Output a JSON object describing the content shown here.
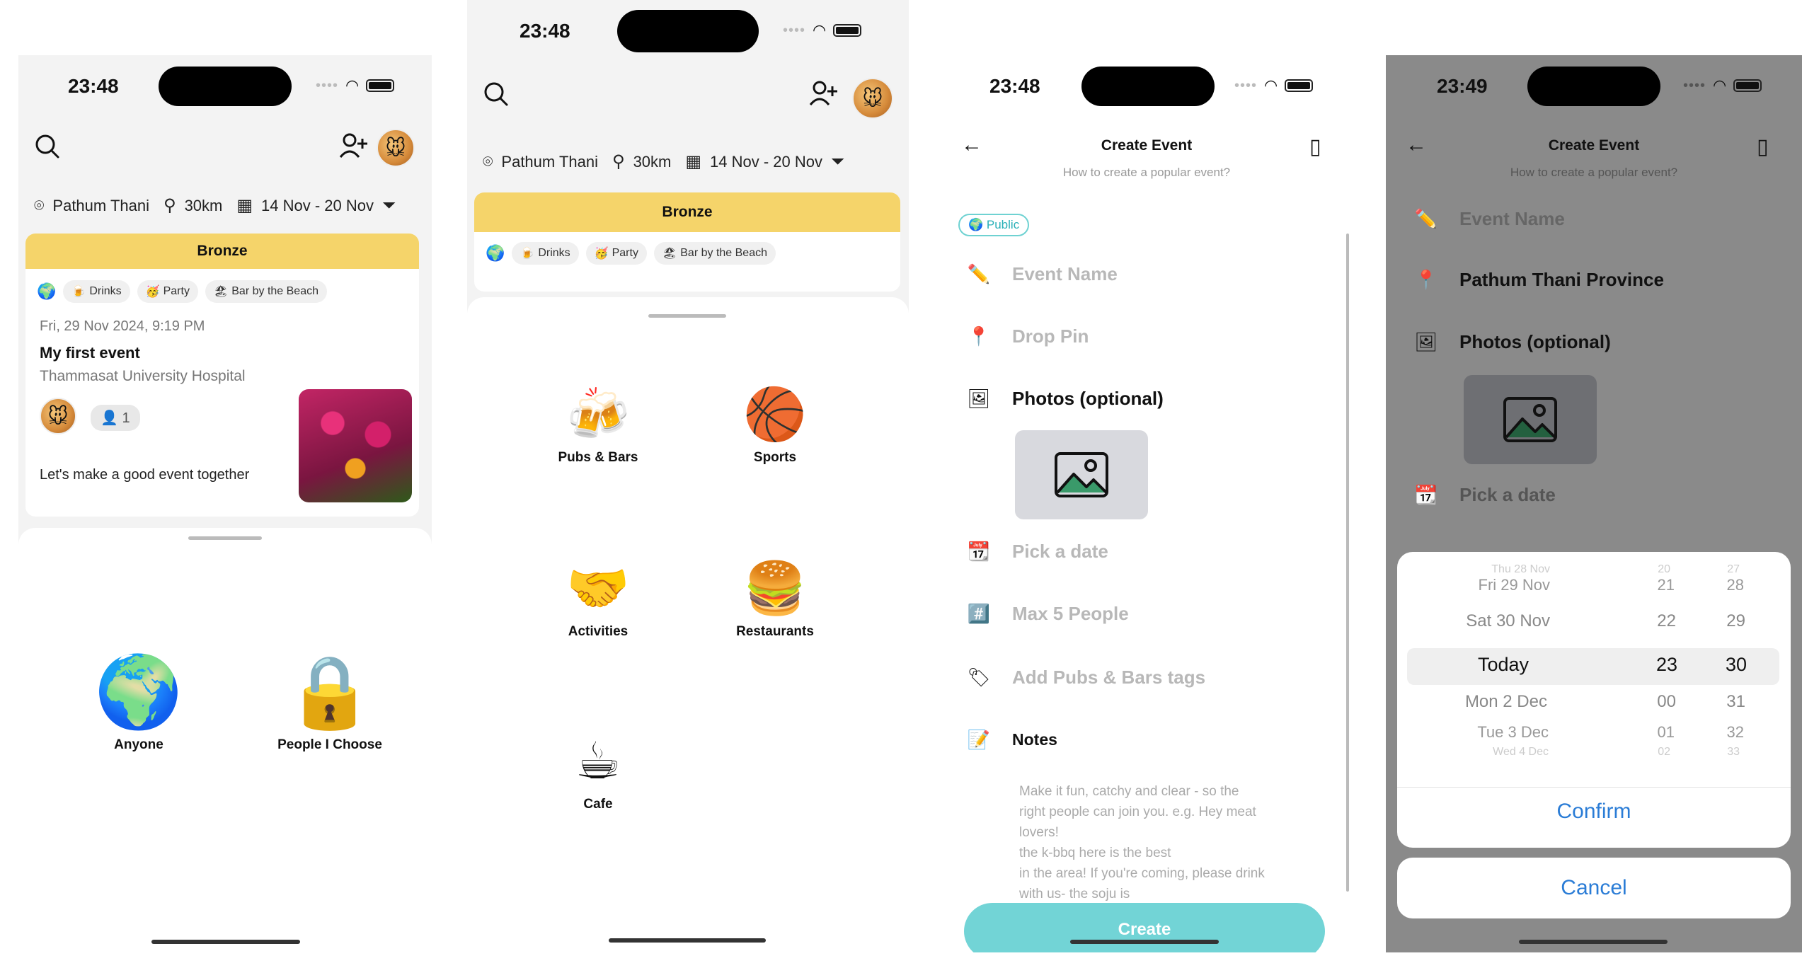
{
  "screen1": {
    "status_time": "23:48",
    "location": "Pathum Thani",
    "distance": "30km",
    "date_range": "14 Nov - 20 Nov",
    "tier": "Bronze",
    "tags": [
      "Drinks",
      "Party",
      "Bar by the Beach"
    ],
    "event": {
      "datetime": "Fri, 29 Nov 2024, 9:19 PM",
      "title": "My first event",
      "venue": "Thammasat University Hospital",
      "attendee_count": "1",
      "description": "Let's make a good event together"
    },
    "options": [
      {
        "label": "Anyone",
        "icon": "globe-icon"
      },
      {
        "label": "People I Choose",
        "icon": "lock-icon"
      }
    ]
  },
  "screen2": {
    "status_time": "23:48",
    "location": "Pathum Thani",
    "distance": "30km",
    "date_range": "14 Nov - 20 Nov",
    "tier": "Bronze",
    "tags": [
      "Drinks",
      "Party",
      "Bar by the Beach"
    ],
    "categories": [
      {
        "label": "Pubs & Bars",
        "icon": "bar-icon"
      },
      {
        "label": "Sports",
        "icon": "sports-icon"
      },
      {
        "label": "Activities",
        "icon": "activities-icon"
      },
      {
        "label": "Restaurants",
        "icon": "restaurant-icon"
      },
      {
        "label": "Cafe",
        "icon": "cafe-icon"
      }
    ]
  },
  "screen3": {
    "status_time": "23:48",
    "title": "Create Event",
    "subtitle": "How to create a popular event?",
    "visibility": "Public",
    "event_name_placeholder": "Event Name",
    "drop_pin": "Drop Pin",
    "photos": "Photos (optional)",
    "pick_date": "Pick a date",
    "max_people": "Max 5 People",
    "add_tags": "Add Pubs & Bars tags",
    "notes_label": "Notes",
    "notes_placeholder_lines": [
      "Make it fun, catchy and clear - so the",
      "right people can join you. e.g. Hey meat",
      "lovers!",
      "the k-bbq here is the best",
      "in the area! If you're coming, please drink",
      "with us- the soju is"
    ],
    "create_label": "Create"
  },
  "screen4": {
    "status_time": "23:49",
    "title": "Create Event",
    "subtitle": "How to create a popular event?",
    "event_name_placeholder": "Event Name",
    "location": "Pathum Thani Province",
    "photos": "Photos (optional)",
    "pick_date": "Pick a date",
    "picker_rows": [
      {
        "day": "Thu 28 Nov",
        "hour": "20",
        "min": "27"
      },
      {
        "day": "Fri 29 Nov",
        "hour": "21",
        "min": "28"
      },
      {
        "day": "Sat 30 Nov",
        "hour": "22",
        "min": "29"
      },
      {
        "day": "Today",
        "hour": "23",
        "min": "30"
      },
      {
        "day": "Mon 2 Dec",
        "hour": "00",
        "min": "31"
      },
      {
        "day": "Tue 3 Dec",
        "hour": "01",
        "min": "32"
      },
      {
        "day": "Wed 4 Dec",
        "hour": "02",
        "min": "33"
      }
    ],
    "confirm_label": "Confirm",
    "cancel_label": "Cancel"
  }
}
